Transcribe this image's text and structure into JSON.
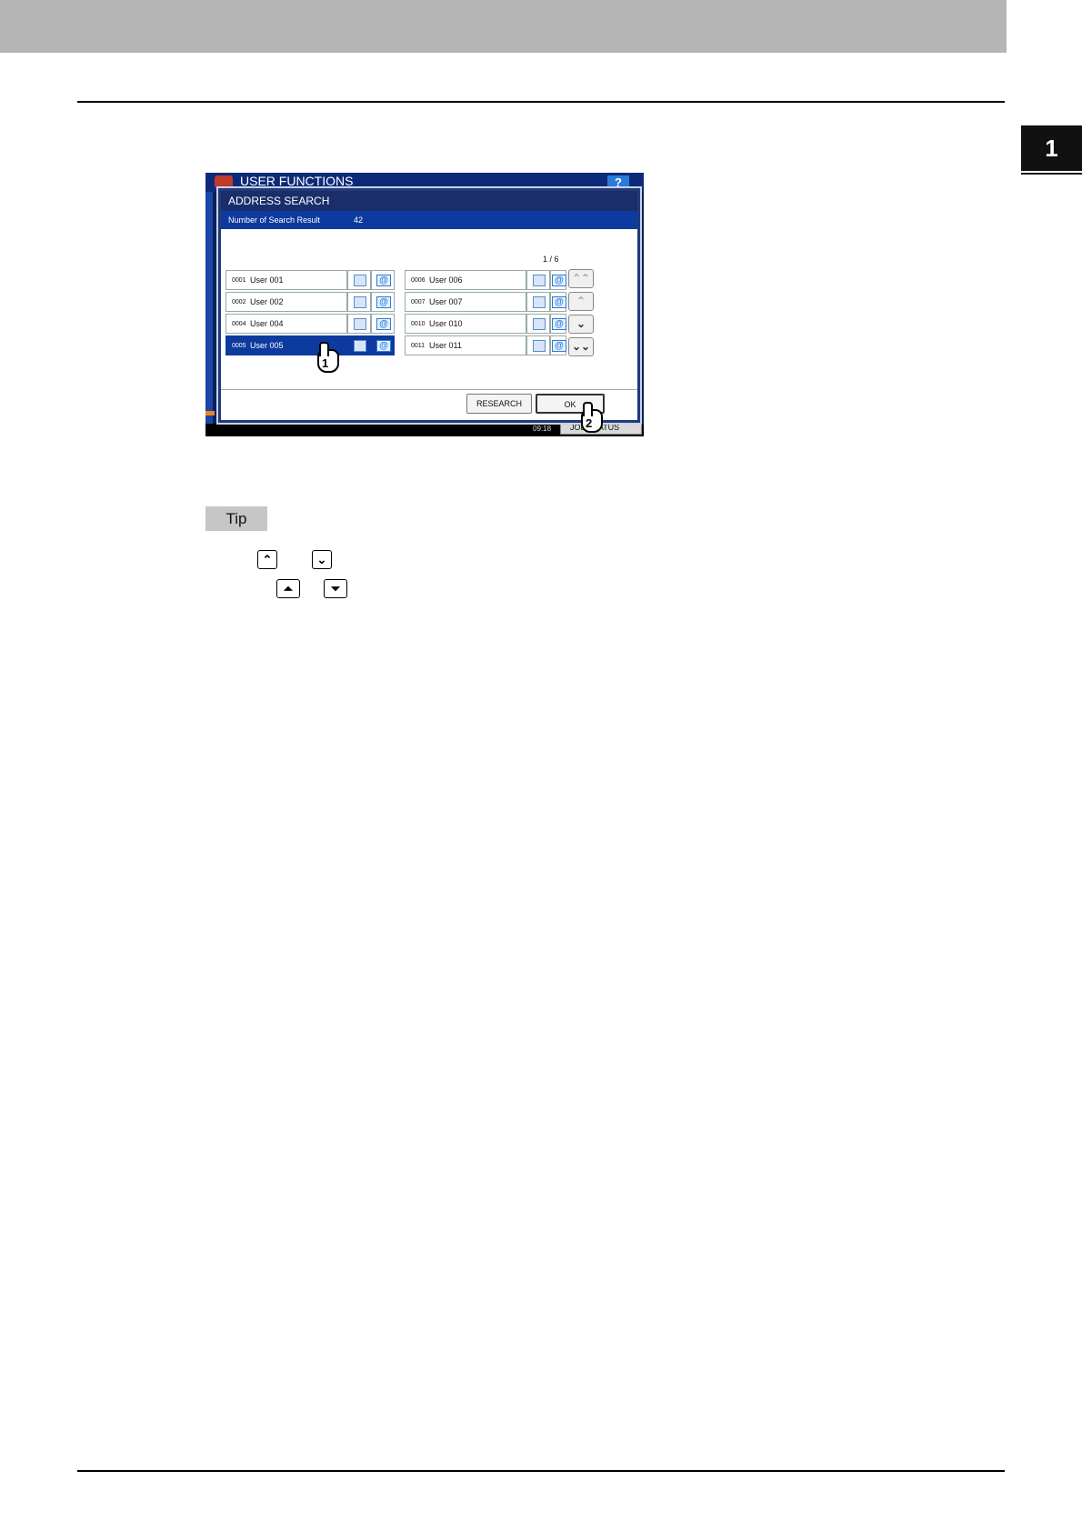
{
  "chapter": {
    "number": "1"
  },
  "screen": {
    "app_title": "USER FUNCTIONS",
    "help_label": "?",
    "dialog_title": "ADDRESS SEARCH",
    "result_label": "Number of Search Result",
    "result_count": "42",
    "pager": "1  /  6",
    "left_column": [
      {
        "num": "0001",
        "name": "User  001",
        "selected": false
      },
      {
        "num": "0002",
        "name": "User  002",
        "selected": false
      },
      {
        "num": "0004",
        "name": "User  004",
        "selected": false
      },
      {
        "num": "0005",
        "name": "User  005",
        "selected": true
      }
    ],
    "right_column": [
      {
        "num": "0006",
        "name": "User  006"
      },
      {
        "num": "0007",
        "name": "User  007"
      },
      {
        "num": "0010",
        "name": "User  010"
      },
      {
        "num": "0011",
        "name": "User  011"
      }
    ],
    "email_icon_glyph": "@",
    "nav": {
      "first": "⌃⌃",
      "up": "⌃",
      "down": "⌄",
      "last": "⌄⌄"
    },
    "research_label": "RESEARCH",
    "ok_label": "OK",
    "time": "09:18",
    "job_status_label": "JOB STATUS",
    "callouts": [
      "1",
      "2"
    ]
  },
  "tip": {
    "label": "Tip",
    "up_key": "⌃",
    "down_key": "⌄",
    "first_key": "⏶",
    "last_key": "⏷"
  },
  "icons": [
    "fax-icon",
    "email-icon",
    "help-icon",
    "hand-pointer-icon",
    "chevron-up-icon",
    "chevron-down-icon",
    "double-chevron-up-icon",
    "double-chevron-down-icon"
  ]
}
